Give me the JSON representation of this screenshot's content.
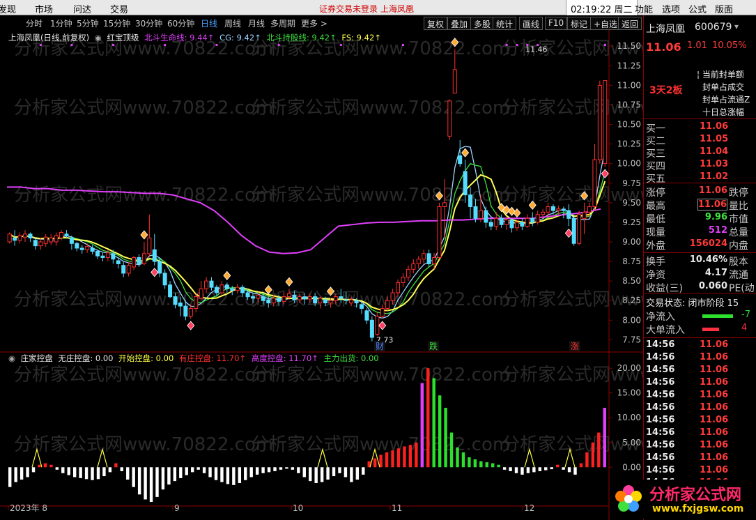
{
  "menu": {
    "items": [
      "发现",
      "市场",
      "问达",
      "交易"
    ],
    "notice": "证券交易未登录  上海凤凰",
    "clock": "02:19:22 周二",
    "right_items": [
      "功能",
      "选项",
      "公式",
      "版面"
    ]
  },
  "periods": [
    "分时",
    "1分钟",
    "5分钟",
    "15分钟",
    "30分钟",
    "60分钟",
    "日线",
    "周线",
    "月线",
    "多周期",
    "更多 >"
  ],
  "active_period": "日线",
  "toolbar": [
    "复权",
    "叠加",
    "多股",
    "统计",
    "画线",
    "F10",
    "标记",
    "+自选",
    "返回"
  ],
  "top_legend": {
    "title": "上海凤凰(日线,前复权)",
    "indicator": "红宝顶级",
    "items": [
      {
        "label": "北斗生命线: 9.44↑",
        "color": "#e040fb"
      },
      {
        "label": "CG: 9.42↑",
        "color": "#9fd4ff"
      },
      {
        "label": "北斗持股线: 9.42↑",
        "color": "#3ee03e"
      },
      {
        "label": "FS: 9.42↑",
        "color": "#ffff55"
      }
    ]
  },
  "bottom_legend": {
    "title": "庄家控盘",
    "items": [
      {
        "label": "无庄控盘: 0.00",
        "color": "#e8e8e8"
      },
      {
        "label": "开始控盘: 0.00",
        "color": "#ffff40"
      },
      {
        "label": "有庄控盘: 11.70↑",
        "color": "#ff3030"
      },
      {
        "label": "高度控盘: 11.70↑",
        "color": "#e040fb"
      },
      {
        "label": "主力出货: 0.00",
        "color": "#3ee03e"
      }
    ]
  },
  "watermark": "分析家公式网www.70822.com",
  "annotations": {
    "high_label": "11.46",
    "low_label": "7.73",
    "markers": [
      "财",
      "跌",
      "涨"
    ]
  },
  "x_axis_labels": [
    "2023年 8",
    "9",
    "10",
    "11",
    "12"
  ],
  "right_panel": {
    "name": "上海凤凰",
    "code": "600679",
    "price": "11.06",
    "change": "1.01",
    "pct": "10.05%",
    "streak": "3天2板",
    "seal_info": [
      "当前封单额",
      "封单占成交",
      "封单占流通Z",
      "十日总涨幅"
    ],
    "orders": [
      {
        "label": "买一",
        "value": "11.06"
      },
      {
        "label": "买二",
        "value": "11.05"
      },
      {
        "label": "买三",
        "value": "11.04"
      },
      {
        "label": "买四",
        "value": "11.03"
      },
      {
        "label": "买五",
        "value": "11.02"
      }
    ],
    "stats": [
      {
        "l1": "涨停",
        "v": "11.06",
        "vc": "#ff3b3b",
        "l2": "跌停"
      },
      {
        "l1": "最高",
        "v": "11.06",
        "vc": "#ff3b3b",
        "l2": "量比"
      },
      {
        "l1": "最低",
        "v": "9.96",
        "vc": "#3ee03e",
        "l2": "市值"
      },
      {
        "l1": "现量",
        "v": "512",
        "vc": "#e040fb",
        "l2": "总量"
      },
      {
        "l1": "外盘",
        "v": "156024",
        "vc": "#ff3b3b",
        "l2": "内盘"
      }
    ],
    "stats2": [
      {
        "l1": "换手",
        "v": "10.46%",
        "vc": "#e8e8e8",
        "l2": "股本"
      },
      {
        "l1": "净资",
        "v": "4.17",
        "vc": "#e8e8e8",
        "l2": "流通"
      },
      {
        "l1": "收益(三)",
        "v": "0.060",
        "vc": "#e8e8e8",
        "l2": "PE(动"
      }
    ],
    "state": "交易状态: 闭市阶段 15",
    "net_in": {
      "label": "净流入",
      "value": "-7"
    },
    "big_in": {
      "label": "大单流入",
      "value": "4"
    },
    "ticks_time": "14:56",
    "ticks_value": "11.06",
    "tick_count": 12
  },
  "logo": {
    "text": "分析家公式网",
    "url": "www.fxjgsw.com"
  },
  "chart_data": [
    {
      "type": "candlestick",
      "y_ticks": [
        11.5,
        11.25,
        11.0,
        10.75,
        10.5,
        10.25,
        10.0,
        9.75,
        9.5,
        9.25,
        9.0,
        8.75,
        8.5,
        8.25,
        8.0,
        7.75
      ],
      "ylim": [
        7.7,
        11.6
      ],
      "candles": [
        [
          9.0,
          9.1,
          8.98,
          9.12
        ],
        [
          9.05,
          9.02,
          8.95,
          9.15
        ],
        [
          9.02,
          9.08,
          8.98,
          9.12
        ],
        [
          9.06,
          9.1,
          9.0,
          9.15
        ],
        [
          9.1,
          9.05,
          9.0,
          9.12
        ],
        [
          9.02,
          8.95,
          8.9,
          9.05
        ],
        [
          8.95,
          9.0,
          8.9,
          9.05
        ],
        [
          8.98,
          9.06,
          8.94,
          9.1
        ],
        [
          9.0,
          9.05,
          8.96,
          9.1
        ],
        [
          9.0,
          9.08,
          8.95,
          9.12
        ],
        [
          9.05,
          9.12,
          9.02,
          9.15
        ],
        [
          9.1,
          9.08,
          9.05,
          9.15
        ],
        [
          9.05,
          8.98,
          8.9,
          9.08
        ],
        [
          8.98,
          8.92,
          8.88,
          9.0
        ],
        [
          8.92,
          8.9,
          8.85,
          8.96
        ],
        [
          8.9,
          8.94,
          8.86,
          8.98
        ],
        [
          8.92,
          8.88,
          8.84,
          8.96
        ],
        [
          8.88,
          8.82,
          8.78,
          8.9
        ],
        [
          8.82,
          8.8,
          8.75,
          8.86
        ],
        [
          8.8,
          8.86,
          8.76,
          8.9
        ],
        [
          8.85,
          8.78,
          8.72,
          8.9
        ],
        [
          8.76,
          8.72,
          8.66,
          8.8
        ],
        [
          8.7,
          8.6,
          8.55,
          8.75
        ],
        [
          8.6,
          8.7,
          8.56,
          8.74
        ],
        [
          8.68,
          8.8,
          8.64,
          8.82
        ],
        [
          8.8,
          8.72,
          8.68,
          8.84
        ],
        [
          8.72,
          8.85,
          8.7,
          9.0
        ],
        [
          8.85,
          9.05,
          8.8,
          9.35
        ],
        [
          8.9,
          8.75,
          8.7,
          9.1
        ],
        [
          8.75,
          8.6,
          8.55,
          8.8
        ],
        [
          8.6,
          8.45,
          8.4,
          8.65
        ],
        [
          8.45,
          8.3,
          8.28,
          8.5
        ],
        [
          8.3,
          8.2,
          8.15,
          8.35
        ],
        [
          8.22,
          8.18,
          8.05,
          8.3
        ],
        [
          8.18,
          8.05,
          8.0,
          8.25
        ],
        [
          8.05,
          8.15,
          8.02,
          8.2
        ],
        [
          8.15,
          8.3,
          8.1,
          8.35
        ],
        [
          8.28,
          8.4,
          8.25,
          8.5
        ],
        [
          8.4,
          8.5,
          8.35,
          8.55
        ],
        [
          8.5,
          8.42,
          8.38,
          8.55
        ],
        [
          8.42,
          8.35,
          8.3,
          8.45
        ],
        [
          8.35,
          8.45,
          8.32,
          8.5
        ],
        [
          8.45,
          8.4,
          8.35,
          8.48
        ],
        [
          8.4,
          8.38,
          8.32,
          8.44
        ],
        [
          8.38,
          8.42,
          8.34,
          8.46
        ],
        [
          8.42,
          8.35,
          8.3,
          8.45
        ],
        [
          8.35,
          8.3,
          8.26,
          8.4
        ],
        [
          8.3,
          8.28,
          8.22,
          8.34
        ],
        [
          8.28,
          8.32,
          8.22,
          8.36
        ],
        [
          8.3,
          8.25,
          8.2,
          8.35
        ],
        [
          8.26,
          8.22,
          8.16,
          8.3
        ],
        [
          8.22,
          8.28,
          8.18,
          8.32
        ],
        [
          8.28,
          8.24,
          8.18,
          8.32
        ],
        [
          8.24,
          8.3,
          8.2,
          8.36
        ],
        [
          8.3,
          8.34,
          8.26,
          8.4
        ],
        [
          8.32,
          8.26,
          8.22,
          8.38
        ],
        [
          8.26,
          8.3,
          8.22,
          8.34
        ],
        [
          8.3,
          8.27,
          8.2,
          8.35
        ],
        [
          8.27,
          8.3,
          8.22,
          8.34
        ],
        [
          8.3,
          8.22,
          8.18,
          8.35
        ],
        [
          8.22,
          8.28,
          8.15,
          8.3
        ],
        [
          8.26,
          8.22,
          8.18,
          8.3
        ],
        [
          8.22,
          8.25,
          8.16,
          8.28
        ],
        [
          8.25,
          8.3,
          8.2,
          8.34
        ],
        [
          8.3,
          8.28,
          8.22,
          8.4
        ],
        [
          8.26,
          8.25,
          8.2,
          8.36
        ],
        [
          8.22,
          8.26,
          8.18,
          8.3
        ],
        [
          8.25,
          8.22,
          8.16,
          8.28
        ],
        [
          8.2,
          8.15,
          8.08,
          8.24
        ],
        [
          8.12,
          8.0,
          7.95,
          8.15
        ],
        [
          8.0,
          7.78,
          7.73,
          8.05
        ],
        [
          7.82,
          8.05,
          7.8,
          8.1
        ],
        [
          8.05,
          8.15,
          8.02,
          8.2
        ],
        [
          8.15,
          8.25,
          8.12,
          8.3
        ],
        [
          8.25,
          8.35,
          8.2,
          8.4
        ],
        [
          8.35,
          8.48,
          8.3,
          8.52
        ],
        [
          8.48,
          8.55,
          8.42,
          8.6
        ],
        [
          8.55,
          8.65,
          8.5,
          8.7
        ],
        [
          8.65,
          8.72,
          8.6,
          8.78
        ],
        [
          8.72,
          8.78,
          8.66,
          8.82
        ],
        [
          8.78,
          8.85,
          8.72,
          8.9
        ],
        [
          8.85,
          8.72,
          8.68,
          8.9
        ],
        [
          8.72,
          8.8,
          8.65,
          8.86
        ],
        [
          8.8,
          9.45,
          8.78,
          9.5
        ],
        [
          9.45,
          9.5,
          9.05,
          9.8
        ],
        [
          10.35,
          10.8,
          10.3,
          10.82
        ],
        [
          10.9,
          11.2,
          10.9,
          11.46
        ],
        [
          10.1,
          10.0,
          9.96,
          10.3
        ],
        [
          9.9,
          9.6,
          9.5,
          10.05
        ],
        [
          9.6,
          9.45,
          9.3,
          9.7
        ],
        [
          9.45,
          9.3,
          9.25,
          9.55
        ],
        [
          9.3,
          9.4,
          9.25,
          9.6
        ],
        [
          9.4,
          9.25,
          9.18,
          9.45
        ],
        [
          9.25,
          9.2,
          9.15,
          9.3
        ],
        [
          9.2,
          9.3,
          9.15,
          9.38
        ],
        [
          9.3,
          9.22,
          9.18,
          9.35
        ],
        [
          9.22,
          9.28,
          9.15,
          9.32
        ],
        [
          9.28,
          9.18,
          9.12,
          9.3
        ],
        [
          9.18,
          9.25,
          9.14,
          9.28
        ],
        [
          9.25,
          9.2,
          9.15,
          9.3
        ],
        [
          9.2,
          9.3,
          9.18,
          9.35
        ],
        [
          9.3,
          9.25,
          9.2,
          9.38
        ],
        [
          9.25,
          9.35,
          9.22,
          9.4
        ],
        [
          9.35,
          9.38,
          9.3,
          9.42
        ],
        [
          9.38,
          9.45,
          9.32,
          9.5
        ],
        [
          9.45,
          9.4,
          9.35,
          9.48
        ],
        [
          9.4,
          9.42,
          9.35,
          9.46
        ],
        [
          9.42,
          9.4,
          9.3,
          9.45
        ],
        [
          9.4,
          9.3,
          9.2,
          9.48
        ],
        [
          9.3,
          8.98,
          8.95,
          9.35
        ],
        [
          8.98,
          9.35,
          8.96,
          9.4
        ],
        [
          9.3,
          9.38,
          9.1,
          9.5
        ],
        [
          9.38,
          9.45,
          9.32,
          9.5
        ],
        [
          9.45,
          10.05,
          9.4,
          10.25
        ],
        [
          10.05,
          11.0,
          10.0,
          11.06
        ],
        [
          10.0,
          11.06,
          9.96,
          11.06
        ]
      ],
      "ma_lines": [
        {
          "name": "北斗生命线",
          "color": "#e040fb",
          "values": [
            9.7,
            9.7,
            9.68,
            9.68,
            9.66,
            9.66,
            9.65,
            9.64,
            9.64,
            9.63,
            9.62,
            9.62,
            9.6,
            9.55,
            9.5,
            9.4,
            9.25,
            9.08,
            8.95,
            8.87,
            8.85,
            8.86,
            8.9,
            9.05,
            9.2,
            9.22,
            9.24,
            9.25,
            9.25,
            9.26,
            9.27,
            9.27,
            9.28,
            9.28,
            9.29,
            9.3,
            9.3,
            9.3,
            9.3,
            9.32,
            9.34,
            9.36,
            9.38,
            9.42
          ]
        },
        {
          "name": "CG",
          "color": "#9fd4ff"
        },
        {
          "name": "北斗持股线",
          "color": "#3ee03e"
        },
        {
          "name": "FS",
          "color": "#ffff55"
        }
      ]
    },
    {
      "type": "bar",
      "y_ticks": [
        20.0,
        15.0,
        10.0,
        5.0,
        0.0
      ],
      "ylim": [
        -7,
        22
      ],
      "series": [
        {
          "name": "无庄控盘",
          "color": "#ffffff"
        },
        {
          "name": "有庄控盘",
          "color": "#ff2020"
        },
        {
          "name": "高度控盘",
          "color": "#e040fb"
        },
        {
          "name": "主力出货",
          "color": "#2ee02e"
        },
        {
          "name": "开始控盘",
          "color": "#ffff40"
        }
      ],
      "values": [
        -4,
        -3,
        -2.5,
        -2,
        -1,
        0.5,
        0.8,
        0.5,
        -0.5,
        -1.2,
        -1.6,
        -2,
        -2.2,
        -2.4,
        -2.6,
        -2.4,
        -1.8,
        -1,
        0.8,
        -0.8,
        -2.5,
        -4,
        -5.5,
        -6.5,
        -7,
        -6,
        -4.5,
        -3.5,
        -2.8,
        -2.2,
        -1.6,
        -1,
        -0.5,
        -1.2,
        -2,
        -2.6,
        -3,
        -3.4,
        -3.6,
        -3.2,
        -2.6,
        -2,
        -1.5,
        -1.2,
        -1,
        -0.8,
        -0.5,
        -0.3,
        -0.5,
        -1.2,
        -2,
        -2.8,
        -3.2,
        -3,
        -2.5,
        -1.8,
        -1.2,
        -2,
        -3,
        -2.5,
        -1.5,
        1.2,
        1.8,
        2.5,
        3,
        3.4,
        3.8,
        4.2,
        4.5,
        5,
        17,
        20,
        18,
        14.5,
        12,
        7,
        4,
        3,
        2,
        1.6,
        1.2,
        1,
        0.8,
        0.5,
        -0.5,
        -0.8,
        -1.2,
        -1.5,
        -1.2,
        -1,
        -0.8,
        -0.6,
        -0.4,
        0.5,
        -0.5,
        -1,
        -1.5,
        0.8,
        3,
        5,
        7,
        12
      ],
      "kinds": [
        "w",
        "w",
        "w",
        "w",
        "w",
        "r",
        "r",
        "r",
        "w",
        "w",
        "w",
        "w",
        "w",
        "w",
        "w",
        "w",
        "w",
        "w",
        "r",
        "w",
        "w",
        "w",
        "w",
        "w",
        "w",
        "w",
        "w",
        "w",
        "w",
        "w",
        "w",
        "w",
        "w",
        "w",
        "w",
        "w",
        "w",
        "w",
        "w",
        "w",
        "w",
        "w",
        "w",
        "w",
        "w",
        "w",
        "w",
        "w",
        "w",
        "w",
        "w",
        "w",
        "w",
        "w",
        "w",
        "w",
        "w",
        "w",
        "w",
        "w",
        "w",
        "r",
        "r",
        "r",
        "r",
        "r",
        "r",
        "r",
        "r",
        "r",
        "m",
        "r",
        "g",
        "g",
        "g",
        "g",
        "g",
        "g",
        "g",
        "g",
        "g",
        "g",
        "g",
        "g",
        "w",
        "w",
        "w",
        "w",
        "w",
        "w",
        "w",
        "w",
        "w",
        "r",
        "w",
        "w",
        "w",
        "r",
        "r",
        "r",
        "r",
        "m"
      ],
      "spikes": [
        8,
        24,
        76,
        87,
        121,
        134,
        136,
        142
      ]
    }
  ]
}
